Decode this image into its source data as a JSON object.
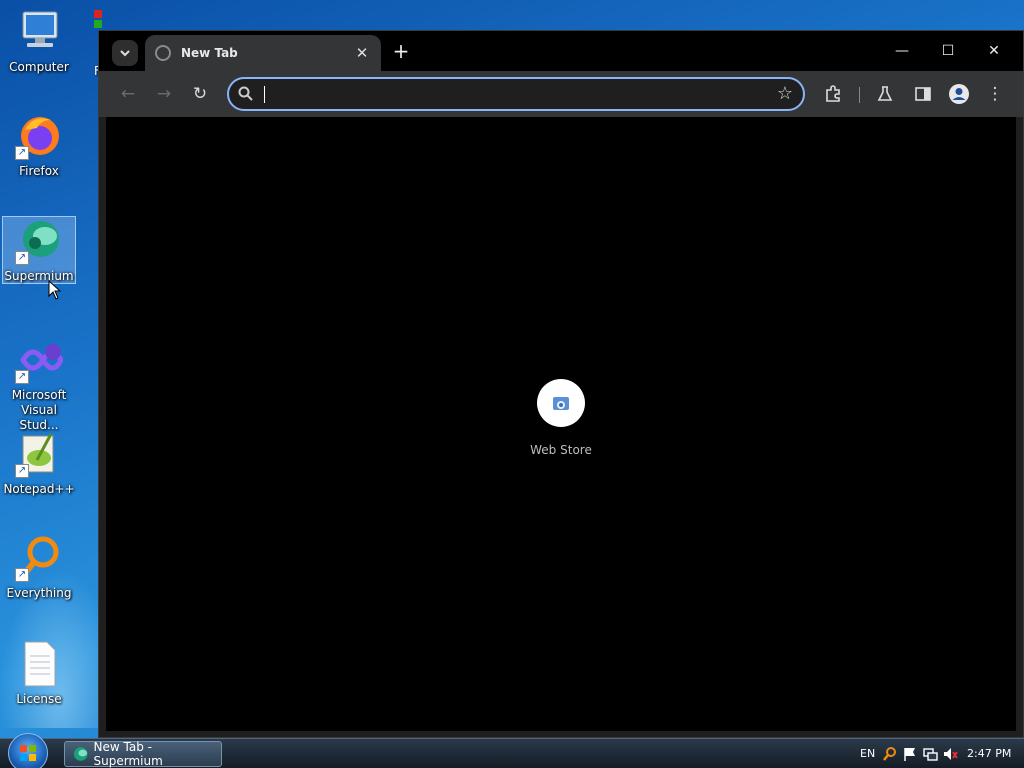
{
  "desktop": {
    "icons": [
      {
        "label": "Computer"
      },
      {
        "label": "Firefox"
      },
      {
        "label": "Supermium"
      },
      {
        "label": "Microsoft Visual Stud..."
      },
      {
        "label": "Notepad++"
      },
      {
        "label": "Everything"
      },
      {
        "label": "License"
      }
    ],
    "partial_icon_label": "F"
  },
  "browser": {
    "tab": {
      "title": "New Tab"
    },
    "toolbar": {
      "omnibox_value": ""
    },
    "content": {
      "shortcut_label": "Web Store"
    }
  },
  "taskbar": {
    "task_label": "New Tab - Supermium",
    "language": "EN",
    "clock": "2:47 PM"
  },
  "colors": {
    "omnibox_focus": "#8ab4f8",
    "tab_active": "#333537",
    "content_bg": "#000000"
  }
}
